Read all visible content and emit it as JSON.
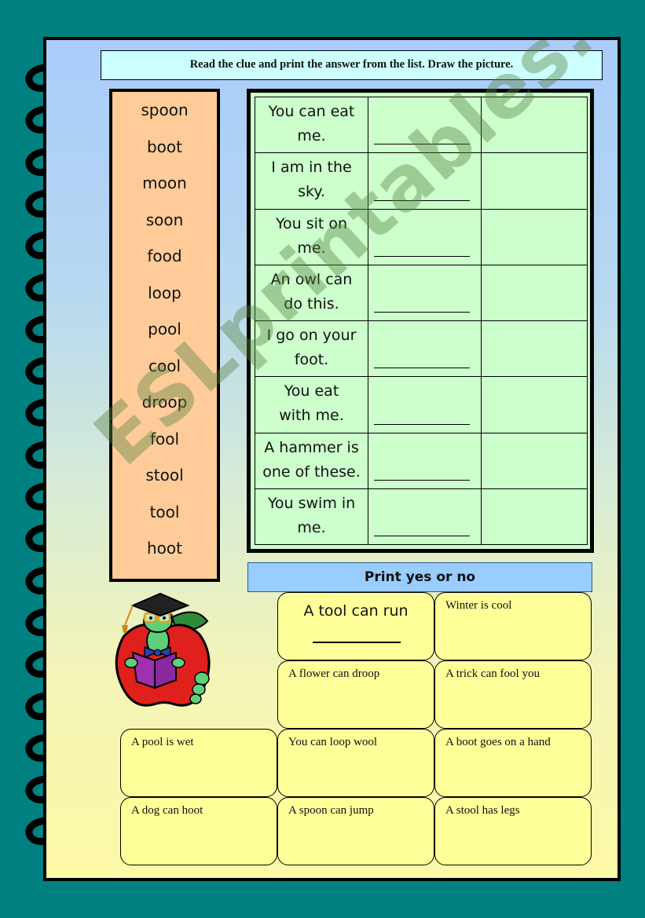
{
  "instruction": "Read the clue and print the answer from the list. Draw the picture.",
  "word_list": [
    "spoon",
    "boot",
    "moon",
    "soon",
    "food",
    "loop",
    "pool",
    "cool",
    "droop",
    "fool",
    "stool",
    "tool",
    "hoot"
  ],
  "clues": [
    {
      "line1": "You can eat",
      "line2": "me."
    },
    {
      "line1": "I am in the",
      "line2": "sky."
    },
    {
      "line1": "You sit on",
      "line2": "me."
    },
    {
      "line1": "An owl can",
      "line2": "do this."
    },
    {
      "line1": "I go on your",
      "line2": "foot."
    },
    {
      "line1": "You eat",
      "line2": "with me."
    },
    {
      "line1": "A hammer is",
      "line2": "one of these."
    },
    {
      "line1": "You swim in",
      "line2": "me."
    }
  ],
  "yes_no": {
    "header": "Print yes or no",
    "statements": [
      "A tool can run",
      "Winter is cool",
      "A flower can droop",
      "A trick can fool you",
      "A pool is wet",
      "You can loop wool",
      "A boot goes on a hand",
      "A dog can hoot",
      "A spoon can jump",
      "A stool has legs"
    ]
  },
  "watermark": "ESLprintables.com",
  "icons": {
    "spiral": "notebook-spiral-binding",
    "mascot": "bookworm-on-apple-illustration"
  },
  "colors": {
    "background": "#008080",
    "instruction_box": "#ccffff",
    "word_list": "#ffcc99",
    "clue_table": "#ccffcc",
    "yes_no_header": "#99ccff",
    "yes_no_box": "#ffff99"
  }
}
